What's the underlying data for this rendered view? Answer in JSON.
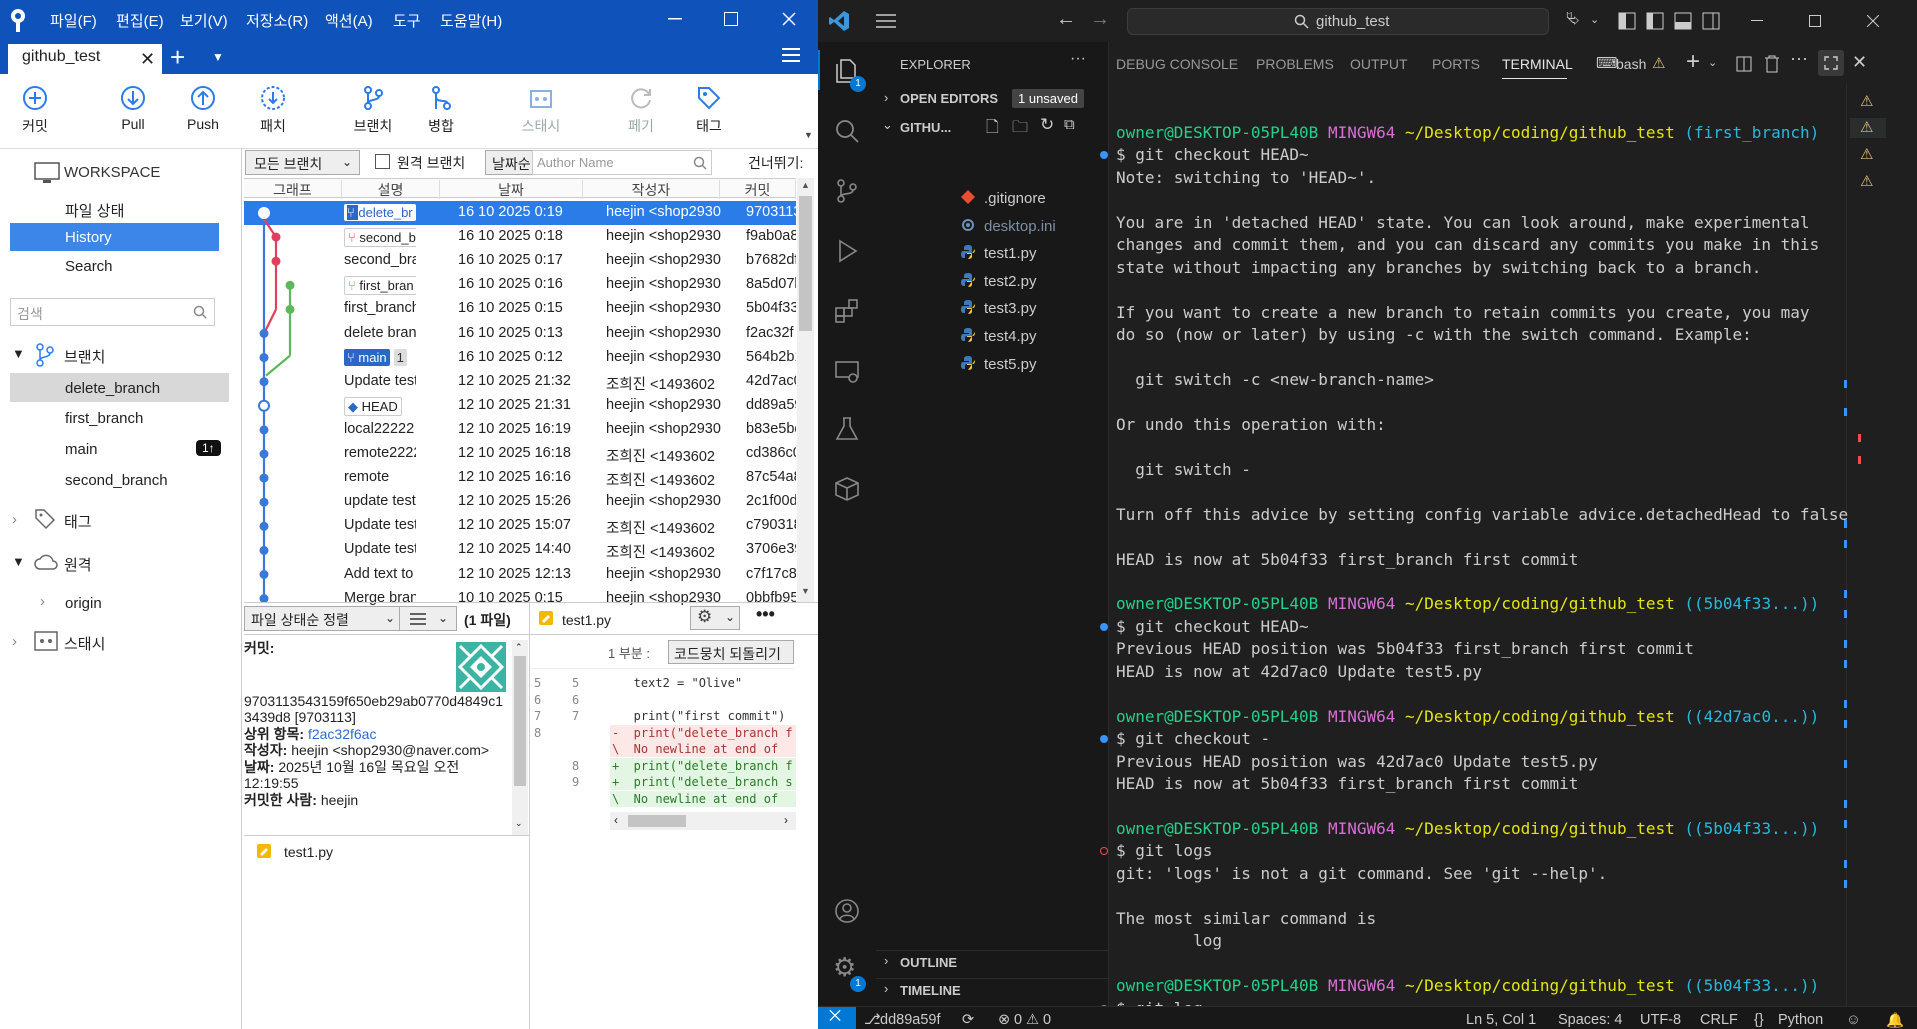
{
  "sourcetree": {
    "menu": [
      "파일(F)",
      "편집(E)",
      "보기(V)",
      "저장소(R)",
      "액션(A)",
      "도구",
      "도움말(H)"
    ],
    "tab": "github_test",
    "toolbar": [
      "커밋",
      "Pull",
      "Push",
      "패치",
      "브랜치",
      "병합",
      "스태시",
      "페기",
      "태그"
    ],
    "sidebar": {
      "workspace": "WORKSPACE",
      "file_status": "파일 상태",
      "history": "History",
      "search": "Search",
      "search_placeholder": "검색",
      "branches_header": "브랜치",
      "branches": [
        "delete_branch",
        "first_branch",
        "main",
        "second_branch"
      ],
      "main_badge": "1↑",
      "tags_header": "태그",
      "remotes_header": "원격",
      "origin": "origin",
      "stash_header": "스태시"
    },
    "filter": {
      "branches": "모든 브랜치",
      "remote_branches": "원격 브랜치",
      "date_order": "날짜순",
      "author_placeholder": "Author Name",
      "skip": "건너뛰기:"
    },
    "columns": [
      "그래프",
      "설명",
      "날짜",
      "작성자",
      "커밋"
    ],
    "commits": [
      {
        "tag": "delete_br",
        "desc": "",
        "date": "16 10 2025 0:19",
        "author": "heejin <shop2930",
        "hash": "9703113"
      },
      {
        "tag": "second_b",
        "desc": "",
        "date": "16 10 2025 0:18",
        "author": "heejin <shop2930",
        "hash": "f9ab0a8"
      },
      {
        "tag": "",
        "desc": "second_brar",
        "date": "16 10 2025 0:17",
        "author": "heejin <shop2930",
        "hash": "b7682df"
      },
      {
        "tag": "first_bran",
        "desc": "",
        "date": "16 10 2025 0:16",
        "author": "heejin <shop2930",
        "hash": "8a5d07b"
      },
      {
        "tag": "",
        "desc": "first_branch",
        "date": "16 10 2025 0:15",
        "author": "heejin <shop2930",
        "hash": "5b04f33"
      },
      {
        "tag": "",
        "desc": "delete branc",
        "date": "16 10 2025 0:13",
        "author": "heejin <shop2930",
        "hash": "f2ac32f"
      },
      {
        "tag": "main",
        "desc": "",
        "date": "16 10 2025 0:12",
        "author": "heejin <shop2930",
        "hash": "564b2b1"
      },
      {
        "tag": "",
        "desc": "Update test!",
        "date": "12 10 2025 21:32",
        "author": "조희진 <1493602",
        "hash": "42d7ac0"
      },
      {
        "tag": "HEAD",
        "desc": "",
        "date": "12 10 2025 21:31",
        "author": "heejin <shop2930",
        "hash": "dd89a59"
      },
      {
        "tag": "",
        "desc": "local22222",
        "date": "12 10 2025 16:19",
        "author": "heejin <shop2930",
        "hash": "b83e5be"
      },
      {
        "tag": "",
        "desc": "remote2222",
        "date": "12 10 2025 16:18",
        "author": "조희진 <1493602",
        "hash": "cd386c0"
      },
      {
        "tag": "",
        "desc": "remote",
        "date": "12 10 2025 16:16",
        "author": "조희진 <1493602",
        "hash": "87c54a8"
      },
      {
        "tag": "",
        "desc": "update test3",
        "date": "12 10 2025 15:26",
        "author": "heejin <shop2930",
        "hash": "2c1f00d"
      },
      {
        "tag": "",
        "desc": "Update test2",
        "date": "12 10 2025 15:07",
        "author": "조희진 <1493602",
        "hash": "c790318"
      },
      {
        "tag": "",
        "desc": "Update test4",
        "date": "12 10 2025 14:40",
        "author": "조희진 <1493602",
        "hash": "3706e39"
      },
      {
        "tag": "",
        "desc": "Add text to",
        "date": "12 10 2025 12:13",
        "author": "heejin <shop2930",
        "hash": "c7f17c8"
      },
      {
        "tag": "",
        "desc": "Merge branc",
        "date": "10 10 2025 0:15",
        "author": "heejin <shop2930",
        "hash": "0bbfb95"
      }
    ],
    "bottom": {
      "sort": "파일 상태순 정렬",
      "file_count": "(1 파일)",
      "file_tab": "test1.py",
      "hunk": "1 부분 :",
      "revert": "코드뭉치 되돌리기",
      "commit_label": "커밋:",
      "commit_hash": "9703113543159f650eb29ab0770d4849c13439d8 [9703113]",
      "parent_label": "상위 항목:",
      "parent": "f2ac32f6ac",
      "author_label": "작성자:",
      "author": "heejin <shop2930@naver.com>",
      "date_label": "날짜:",
      "date": "2025년 10월 16일 목요일 오전 12:19:55",
      "committer_label": "커밋한 사람:",
      "committer": "heejin",
      "file": "test1.py"
    },
    "diff": [
      {
        "o": "5",
        "n": "5",
        "t": "   text2 = \"Olive\"",
        "k": " "
      },
      {
        "o": "6",
        "n": "6",
        "t": "",
        "k": " "
      },
      {
        "o": "7",
        "n": "7",
        "t": "   print(\"first commit\")",
        "k": " "
      },
      {
        "o": "8",
        "n": "",
        "t": "-  print(\"delete_branch f",
        "k": "-"
      },
      {
        "o": "",
        "n": "",
        "t": "\\  No newline at end of",
        "k": "-"
      },
      {
        "o": "",
        "n": "8",
        "t": "+  print(\"delete_branch f",
        "k": "+"
      },
      {
        "o": "",
        "n": "9",
        "t": "+  print(\"delete_branch s",
        "k": "+"
      },
      {
        "o": "",
        "n": "",
        "t": "\\  No newline at end of",
        "k": "+"
      }
    ]
  },
  "vscode": {
    "search": "github_test",
    "explorer": "EXPLORER",
    "open_editors": "OPEN EDITORS",
    "unsaved": "1 unsaved",
    "folder": "GITHU...",
    "files": [
      ".gitignore",
      "desktop.ini",
      "test1.py",
      "test2.py",
      "test3.py",
      "test4.py",
      "test5.py"
    ],
    "outline": "OUTLINE",
    "timeline": "TIMELINE",
    "panel_tabs": [
      "DEBUG CONSOLE",
      "PROBLEMS",
      "OUTPUT",
      "PORTS",
      "TERMINAL"
    ],
    "bash": "bash",
    "badges": [
      "1",
      "1"
    ],
    "status": {
      "branch": "dd89a59f",
      "errors": "0",
      "warnings": "0",
      "pos": "Ln 5, Col 1",
      "spaces": "Spaces: 4",
      "enc": "UTF-8",
      "eol": "CRLF",
      "lang": "Python"
    },
    "terminal": [
      {
        "p": "owner@DESKTOP-05PL40B",
        "e": "MINGW64",
        "d": "~/Desktop/coding/github_test",
        "b": "(first_branch)"
      },
      {
        "t": "$ git checkout HEAD~",
        "dot": "b"
      },
      {
        "t": "Note: switching to 'HEAD~'."
      },
      {
        "t": ""
      },
      {
        "t": "You are in 'detached HEAD' state. You can look around, make experimental"
      },
      {
        "t": "changes and commit them, and you can discard any commits you make in this"
      },
      {
        "t": "state without impacting any branches by switching back to a branch."
      },
      {
        "t": ""
      },
      {
        "t": "If you want to create a new branch to retain commits you create, you may"
      },
      {
        "t": "do so (now or later) by using -c with the switch command. Example:"
      },
      {
        "t": ""
      },
      {
        "t": "  git switch -c <new-branch-name>"
      },
      {
        "t": ""
      },
      {
        "t": "Or undo this operation with:"
      },
      {
        "t": ""
      },
      {
        "t": "  git switch -"
      },
      {
        "t": ""
      },
      {
        "t": "Turn off this advice by setting config variable advice.detachedHead to false"
      },
      {
        "t": ""
      },
      {
        "t": "HEAD is now at 5b04f33 first_branch first commit"
      },
      {
        "t": ""
      },
      {
        "p": "owner@DESKTOP-05PL40B",
        "e": "MINGW64",
        "d": "~/Desktop/coding/github_test",
        "b": "((5b04f33...))"
      },
      {
        "t": "$ git checkout HEAD~",
        "dot": "b"
      },
      {
        "t": "Previous HEAD position was 5b04f33 first_branch first commit"
      },
      {
        "t": "HEAD is now at 42d7ac0 Update test5.py"
      },
      {
        "t": ""
      },
      {
        "p": "owner@DESKTOP-05PL40B",
        "e": "MINGW64",
        "d": "~/Desktop/coding/github_test",
        "b": "((42d7ac0...))"
      },
      {
        "t": "$ git checkout -",
        "dot": "b"
      },
      {
        "t": "Previous HEAD position was 42d7ac0 Update test5.py"
      },
      {
        "t": "HEAD is now at 5b04f33 first_branch first commit"
      },
      {
        "t": ""
      },
      {
        "p": "owner@DESKTOP-05PL40B",
        "e": "MINGW64",
        "d": "~/Desktop/coding/github_test",
        "b": "((5b04f33...))"
      },
      {
        "t": "$ git logs",
        "dot": "r"
      },
      {
        "t": "git: 'logs' is not a git command. See 'git --help'."
      },
      {
        "t": ""
      },
      {
        "t": "The most similar command is"
      },
      {
        "t": "        log"
      },
      {
        "t": ""
      },
      {
        "p": "owner@DESKTOP-05PL40B",
        "e": "MINGW64",
        "d": "~/Desktop/coding/github_test",
        "b": "((5b04f33...))"
      },
      {
        "t": "$ git log",
        "dot": "b"
      }
    ]
  }
}
